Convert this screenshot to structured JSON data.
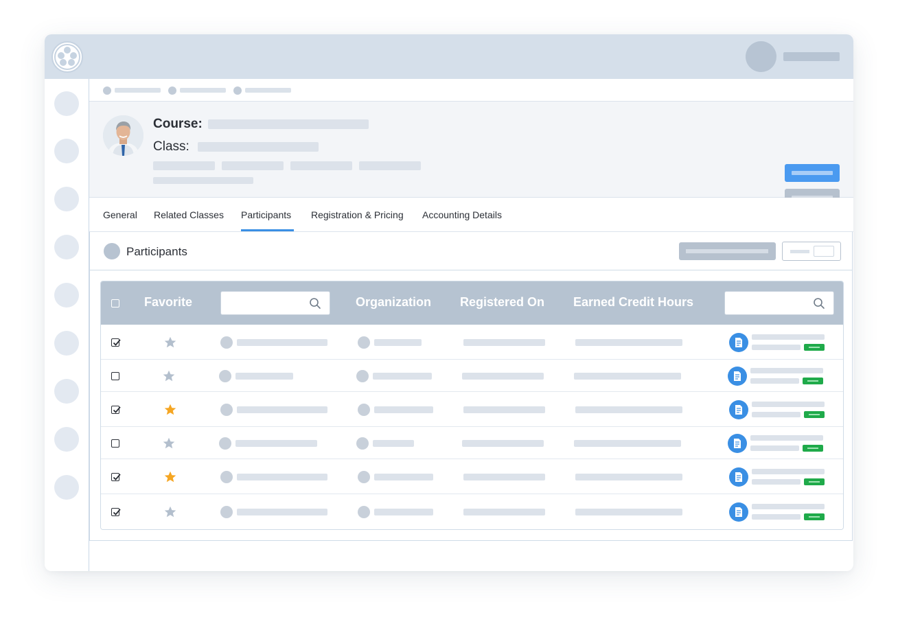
{
  "header": {
    "course_label": "Course:",
    "class_label": "Class:"
  },
  "tabs": [
    {
      "label": "General",
      "active": false
    },
    {
      "label": "Related Classes",
      "active": false
    },
    {
      "label": "Participants",
      "active": true
    },
    {
      "label": "Registration & Pricing",
      "active": false
    },
    {
      "label": "Accounting Details",
      "active": false
    }
  ],
  "panel": {
    "title": "Participants"
  },
  "table": {
    "columns": {
      "favorite": "Favorite",
      "organization": "Organization",
      "registered_on": "Registered On",
      "earned_credit_hours": "Earned Credit Hours"
    },
    "rows": [
      {
        "checked": true,
        "favorite": false
      },
      {
        "checked": false,
        "favorite": false
      },
      {
        "checked": true,
        "favorite": true
      },
      {
        "checked": false,
        "favorite": false
      },
      {
        "checked": true,
        "favorite": true
      },
      {
        "checked": true,
        "favorite": false
      }
    ]
  },
  "colors": {
    "topbar": "#d5dfea",
    "accent_blue": "#3a8fe4",
    "table_header": "#b6c3d1",
    "star_active": "#f5a623",
    "star_inactive": "#b3bfcd",
    "status_green": "#1faa4a"
  },
  "icons": {
    "logo": "film-reel-logo-icon",
    "search": "search-icon",
    "star": "star-icon",
    "document": "document-icon",
    "checkbox": "checkbox-icon"
  }
}
